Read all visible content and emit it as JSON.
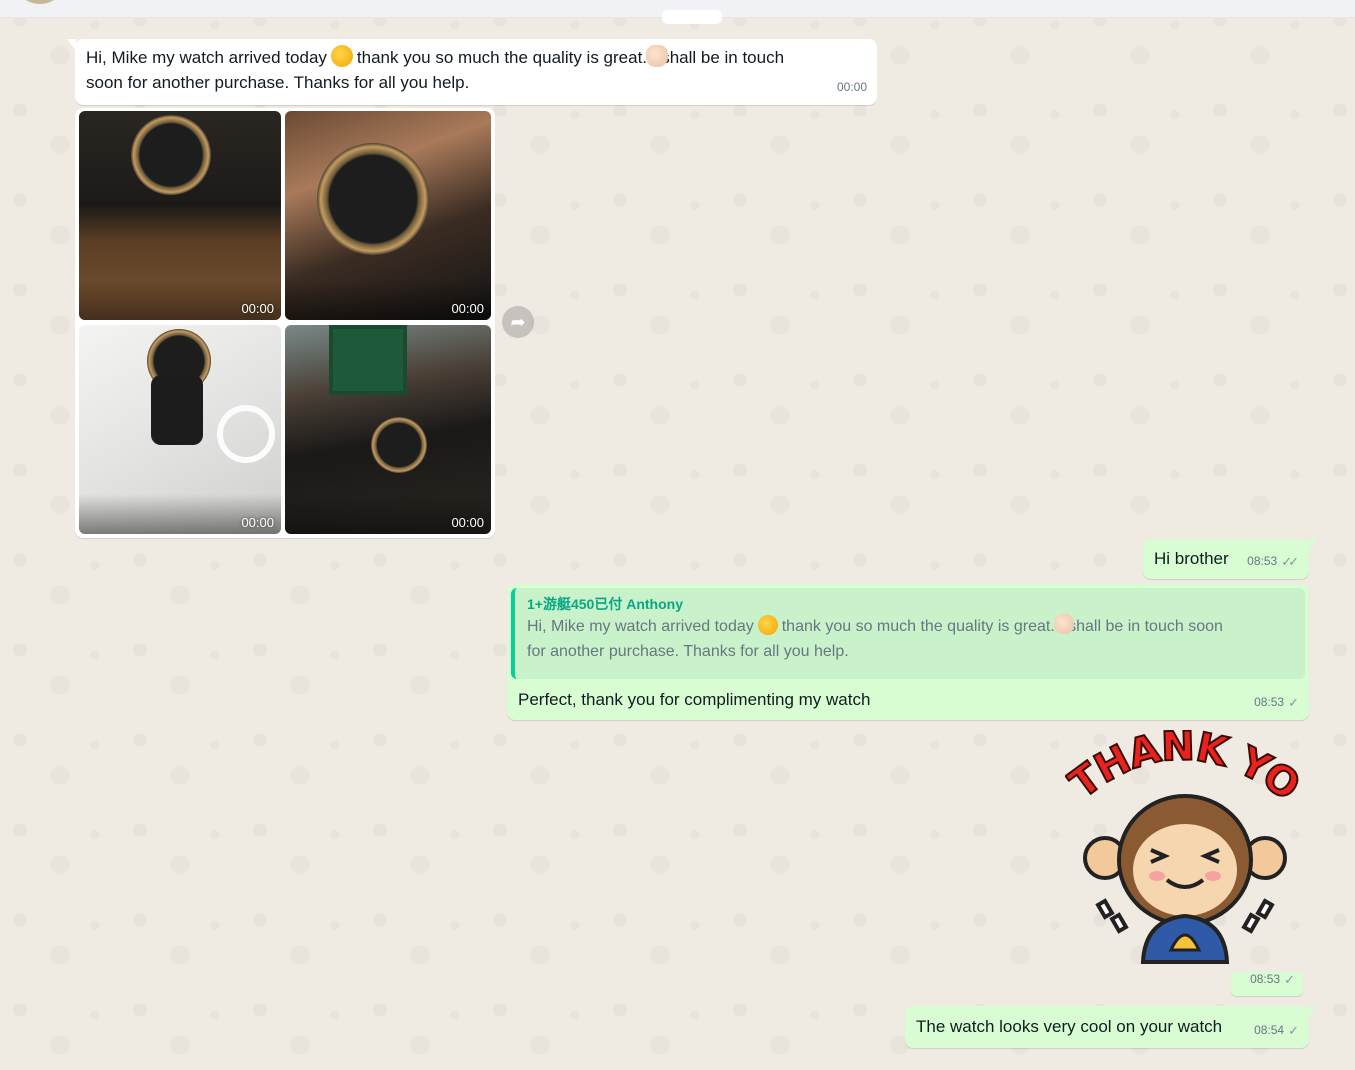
{
  "messages": {
    "incoming_text": {
      "line1_a": "Hi, Mike my watch arrived today",
      "line1_b": "thank you so much the quality is great",
      "line1_c": ". I shall be in touch",
      "line2": "soon for another purchase.  Thanks for all you help.",
      "time": "00:00",
      "emoji1": "oncoming-fist-icon",
      "emoji2": "thumbs-up-icon"
    },
    "photos": [
      {
        "time": "00:00"
      },
      {
        "time": "00:00"
      },
      {
        "time": "00:00"
      },
      {
        "time": "00:00"
      }
    ],
    "hi_brother": {
      "text": "Hi brother",
      "time": "08:53"
    },
    "reply": {
      "quote_author": "1+游艇450已付 Anthony",
      "quote_a": "Hi, Mike my watch arrived today",
      "quote_b": "thank you so much the quality is great",
      "quote_c": ". I shall be in touch soon",
      "quote_line2": "for another purchase.  Thanks for all you help.",
      "text": "Perfect, thank you for complimenting my watch",
      "time": "08:53"
    },
    "sticker": {
      "time": "08:53",
      "caption": "THANK YOU"
    },
    "last": {
      "text": "The watch looks very cool on your watch",
      "time": "08:54"
    }
  },
  "colors": {
    "incoming": "#ffffff",
    "outgoing": "#d9fdd3",
    "quote_accent": "#06cf9c",
    "wallpaper": "#efeae2"
  }
}
